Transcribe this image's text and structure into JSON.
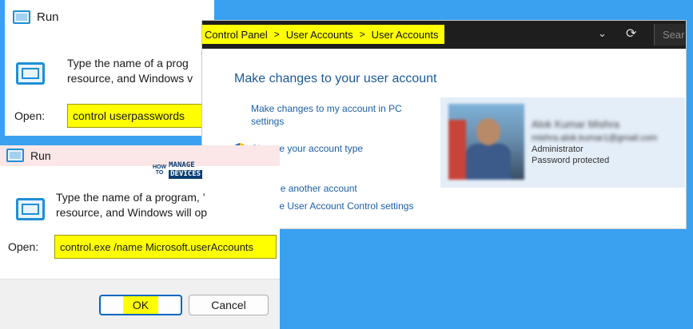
{
  "run_dialog_1": {
    "title": "Run",
    "description_line1": "Type the name of a prog",
    "description_line2": "resource, and Windows v",
    "open_label": "Open:",
    "open_value": "control userpasswords"
  },
  "control_panel": {
    "breadcrumb": [
      "Control Panel",
      "User Accounts",
      "User Accounts"
    ],
    "breadcrumb_separator": ">",
    "search_placeholder": "Sear",
    "heading": "Make changes to your user account",
    "links": {
      "change_account_line1": "Make changes to my account in PC",
      "change_account_line2": "settings",
      "change_type": "Change your account type",
      "manage_another": "Manage another account",
      "uac_settings": "Change User Account Control settings"
    },
    "user_card": {
      "name": "Alok Kumar Mishra",
      "email": "mishra.alok.kumar1@gmail.com",
      "role": "Administrator",
      "status": "Password protected"
    }
  },
  "run_dialog_2": {
    "title": "Run",
    "description_line1": "Type the name of a program, ’",
    "description_line2": "resource, and Windows will op",
    "open_label": "Open:",
    "open_value": "control.exe /name Microsoft.userAccounts",
    "ok_label": "OK",
    "cancel_label": "Cancel"
  },
  "watermark": {
    "how": "HOW",
    "to": "TO",
    "manage": "MANAGE",
    "devices": "DEVICES"
  },
  "colors": {
    "background": "#3aa0f0",
    "highlight": "#ffff00",
    "link": "#1b5fa8",
    "heading": "#1c5a99",
    "shield_blue": "#2f6fcf",
    "shield_yellow": "#f5c400"
  }
}
